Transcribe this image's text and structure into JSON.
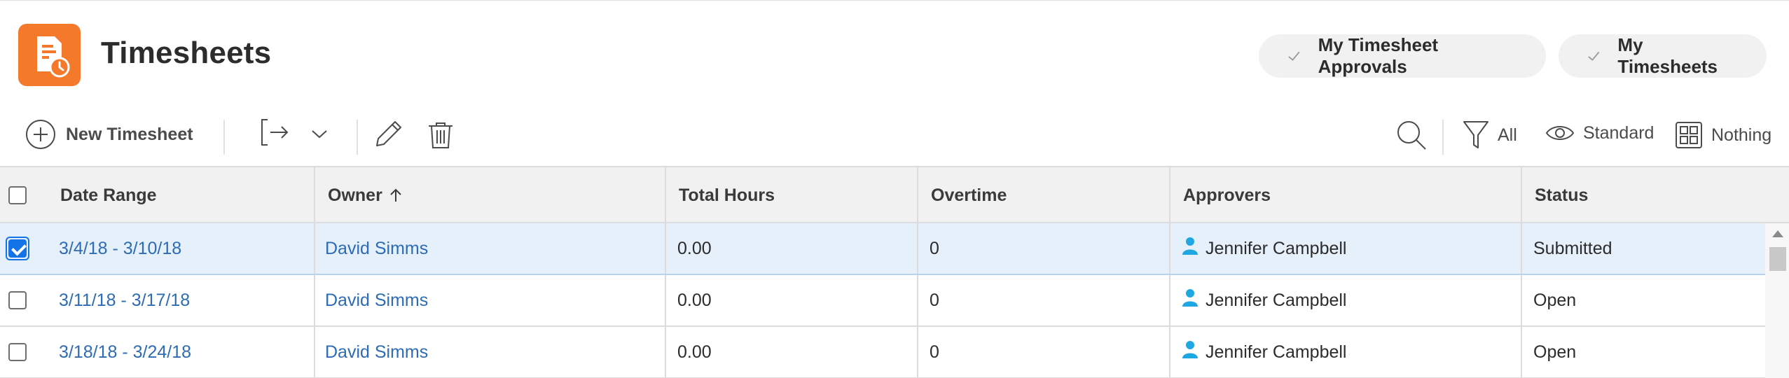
{
  "header": {
    "title": "Timesheets",
    "logo_icon": "timesheet-clock-icon",
    "accent_color": "#f5792a",
    "buttons": [
      {
        "label": "My Timesheet Approvals",
        "icon": "check-icon"
      },
      {
        "label": "My Timesheets",
        "icon": "check-icon"
      }
    ]
  },
  "toolbar": {
    "new_label": "New Timesheet",
    "filter_label": "All",
    "view_label": "Standard",
    "group_label": "Nothing"
  },
  "table": {
    "columns": [
      "Date Range",
      "Owner",
      "Total Hours",
      "Overtime",
      "Approvers",
      "Status"
    ],
    "sorted_column": "Owner",
    "sort_direction": "ascending",
    "rows": [
      {
        "date_range": "3/4/18 - 3/10/18",
        "owner": "David Simms",
        "total_hours": "0.00",
        "overtime": "0",
        "approver": "Jennifer Campbell",
        "status": "Submitted",
        "selected": true
      },
      {
        "date_range": "3/11/18 - 3/17/18",
        "owner": "David Simms",
        "total_hours": "0.00",
        "overtime": "0",
        "approver": "Jennifer Campbell",
        "status": "Open",
        "selected": false
      },
      {
        "date_range": "3/18/18 - 3/24/18",
        "owner": "David Simms",
        "total_hours": "0.00",
        "overtime": "0",
        "approver": "Jennifer Campbell",
        "status": "Open",
        "selected": false
      }
    ]
  },
  "colors": {
    "link": "#2d6cb5",
    "selected_row": "#e5f0fb",
    "checkbox_checked": "#1473e6",
    "user_icon": "#1ea7e1"
  }
}
